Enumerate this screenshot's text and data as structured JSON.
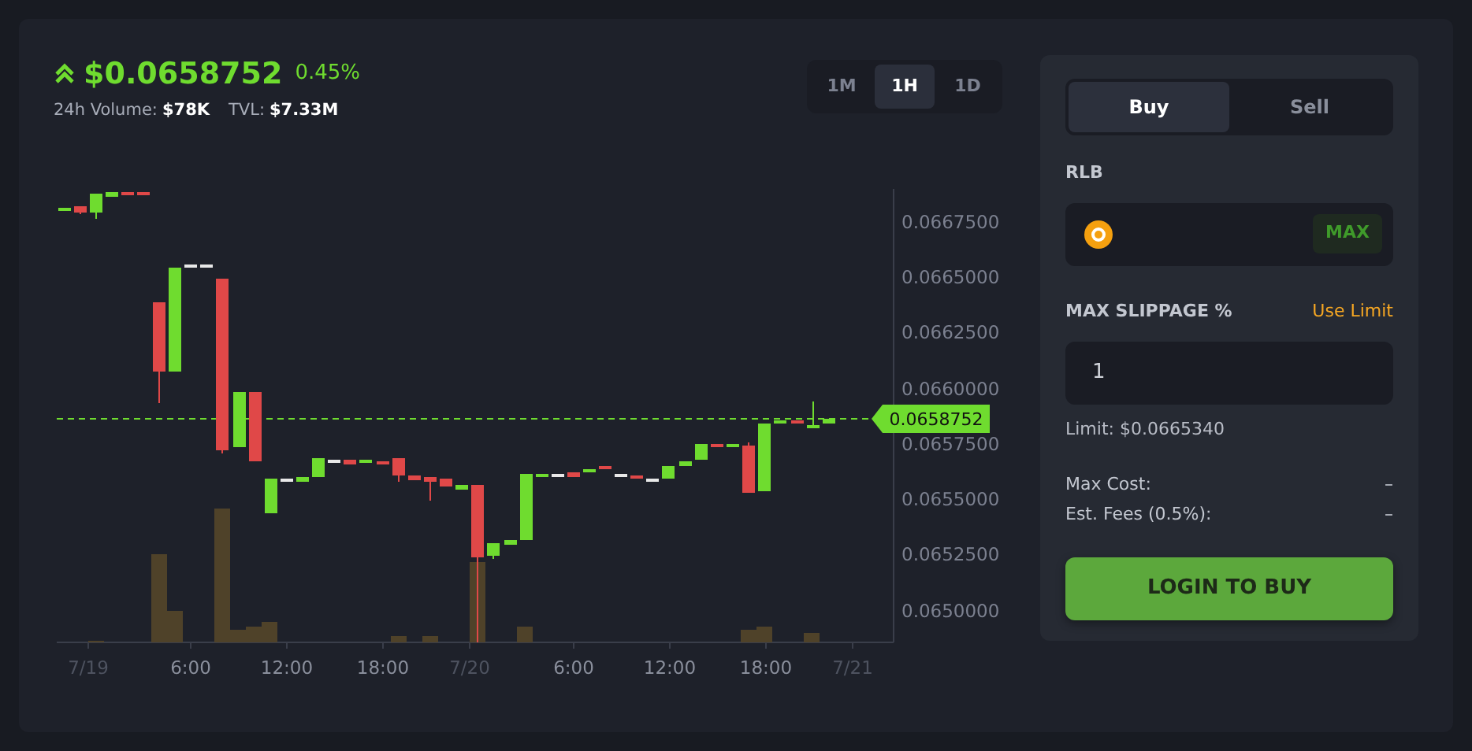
{
  "ticker": {
    "price": "$0.0658752",
    "change": "0.45%",
    "stats": [
      {
        "label": "24h Volume:",
        "value": "$78K"
      },
      {
        "label": "TVL:",
        "value": "$7.33M"
      }
    ]
  },
  "timeframes": [
    {
      "label": "1M",
      "selected": false
    },
    {
      "label": "1H",
      "selected": true
    },
    {
      "label": "1D",
      "selected": false
    }
  ],
  "chart": {
    "price_axis": [
      "0.0667500",
      "0.0665000",
      "0.0662500",
      "0.0660000",
      "0.0657500",
      "0.0655000",
      "0.0652500",
      "0.0650000"
    ],
    "time_axis": [
      "7/19",
      "6:00",
      "12:00",
      "18:00",
      "7/20",
      "6:00",
      "12:00",
      "18:00",
      "7/21"
    ],
    "current_price": "0.0658752"
  },
  "trade_panel": {
    "sides": [
      {
        "label": "Buy",
        "selected": true
      },
      {
        "label": "Sell",
        "selected": false
      }
    ],
    "token_label": "RLB",
    "max_button": "MAX",
    "slippage_label": "MAX SLIPPAGE %",
    "use_limit": "Use Limit",
    "slippage_value": "1",
    "limit": "Limit: $0.0665340",
    "summary": [
      {
        "label": "Max Cost:",
        "value": "–"
      },
      {
        "label": "Est. Fees (0.5%):",
        "value": "–"
      }
    ],
    "submit": "LOGIN TO BUY"
  }
}
